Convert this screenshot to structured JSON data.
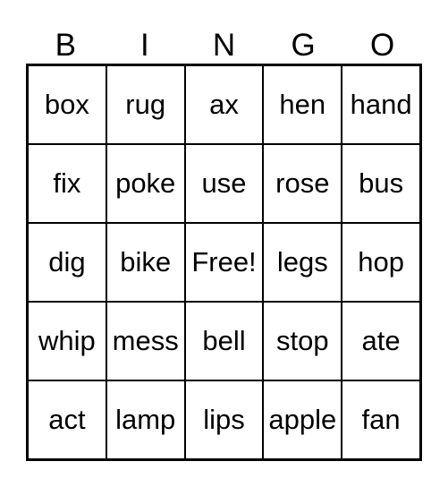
{
  "card": {
    "title_letters": [
      "B",
      "I",
      "N",
      "G",
      "O"
    ],
    "background_color": "#ffffff",
    "line_color": "#000000",
    "text_color": "#000000",
    "rows": [
      [
        "box",
        "rug",
        "ax",
        "hen",
        "hand"
      ],
      [
        "fix",
        "poke",
        "use",
        "rose",
        "bus"
      ],
      [
        "dig",
        "bike",
        "Free!",
        "legs",
        "hop"
      ],
      [
        "whip",
        "mess",
        "bell",
        "stop",
        "ate"
      ],
      [
        "act",
        "lamp",
        "lips",
        "apple",
        "fan"
      ]
    ]
  }
}
